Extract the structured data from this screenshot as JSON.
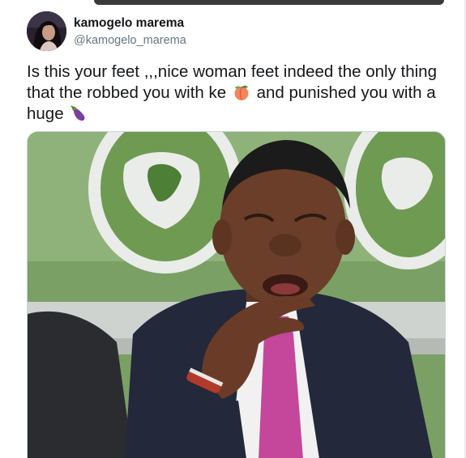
{
  "tweet": {
    "author": {
      "display_name": "kamogelo marema",
      "handle": "@kamogelo_marema",
      "avatar_icon": "profile-avatar"
    },
    "text_part1": "Is this your feet ,,,nice woman feet indeed the only thing that the robbed you with ke",
    "emoji1": "peach-emoji",
    "text_part2": "and punished you with a huge",
    "emoji2": "eggplant-emoji",
    "media": {
      "type": "photo"
    }
  },
  "colors": {
    "text_primary": "#14171a",
    "text_secondary": "#657786",
    "border": "#ccd6dd"
  }
}
